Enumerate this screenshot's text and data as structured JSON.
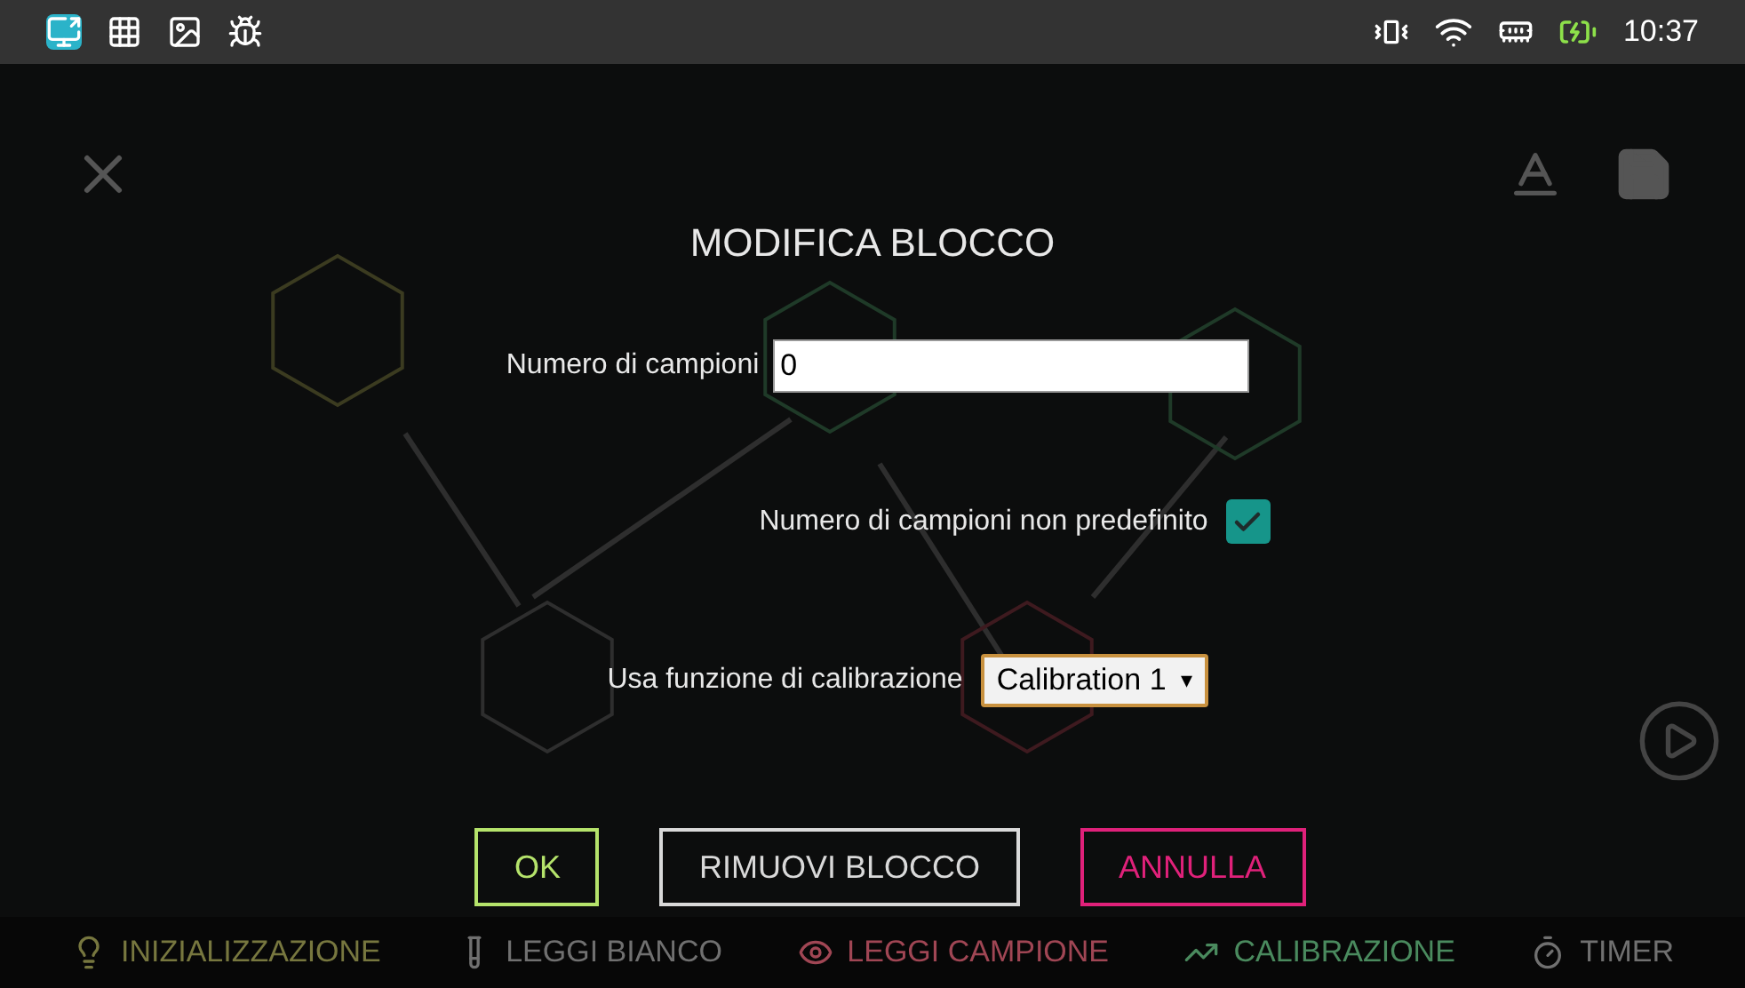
{
  "status_bar": {
    "time": "10:37"
  },
  "dialog": {
    "title": "MODIFICA BLOCCO",
    "sample_count": {
      "label": "Numero di campioni",
      "value": "0"
    },
    "undefined_count": {
      "label": "Numero di campioni non predefinito",
      "checked": true
    },
    "calibration": {
      "label": "Usa funzione di calibrazione",
      "value": "Calibration 1",
      "arrow": "▾"
    },
    "buttons": [
      {
        "label": "OK",
        "color": "#b5e36b"
      },
      {
        "label": "RIMUOVI BLOCCO",
        "color": "#d9d9d9"
      },
      {
        "label": "ANNULLA",
        "color": "#e0217a"
      }
    ]
  },
  "block_bar": {
    "items": [
      {
        "label": "INIZIALIZZAZIONE",
        "kind": "init",
        "color": "#77773f"
      },
      {
        "label": "LEGGI BIANCO",
        "kind": "blank",
        "color": "#707070"
      },
      {
        "label": "LEGGI CAMPIONE",
        "kind": "sample",
        "color": "#a04654"
      },
      {
        "label": "CALIBRAZIONE",
        "kind": "calibration",
        "color": "#4a8a5e"
      },
      {
        "label": "TIMER",
        "kind": "timer",
        "color": "#707070"
      }
    ]
  }
}
